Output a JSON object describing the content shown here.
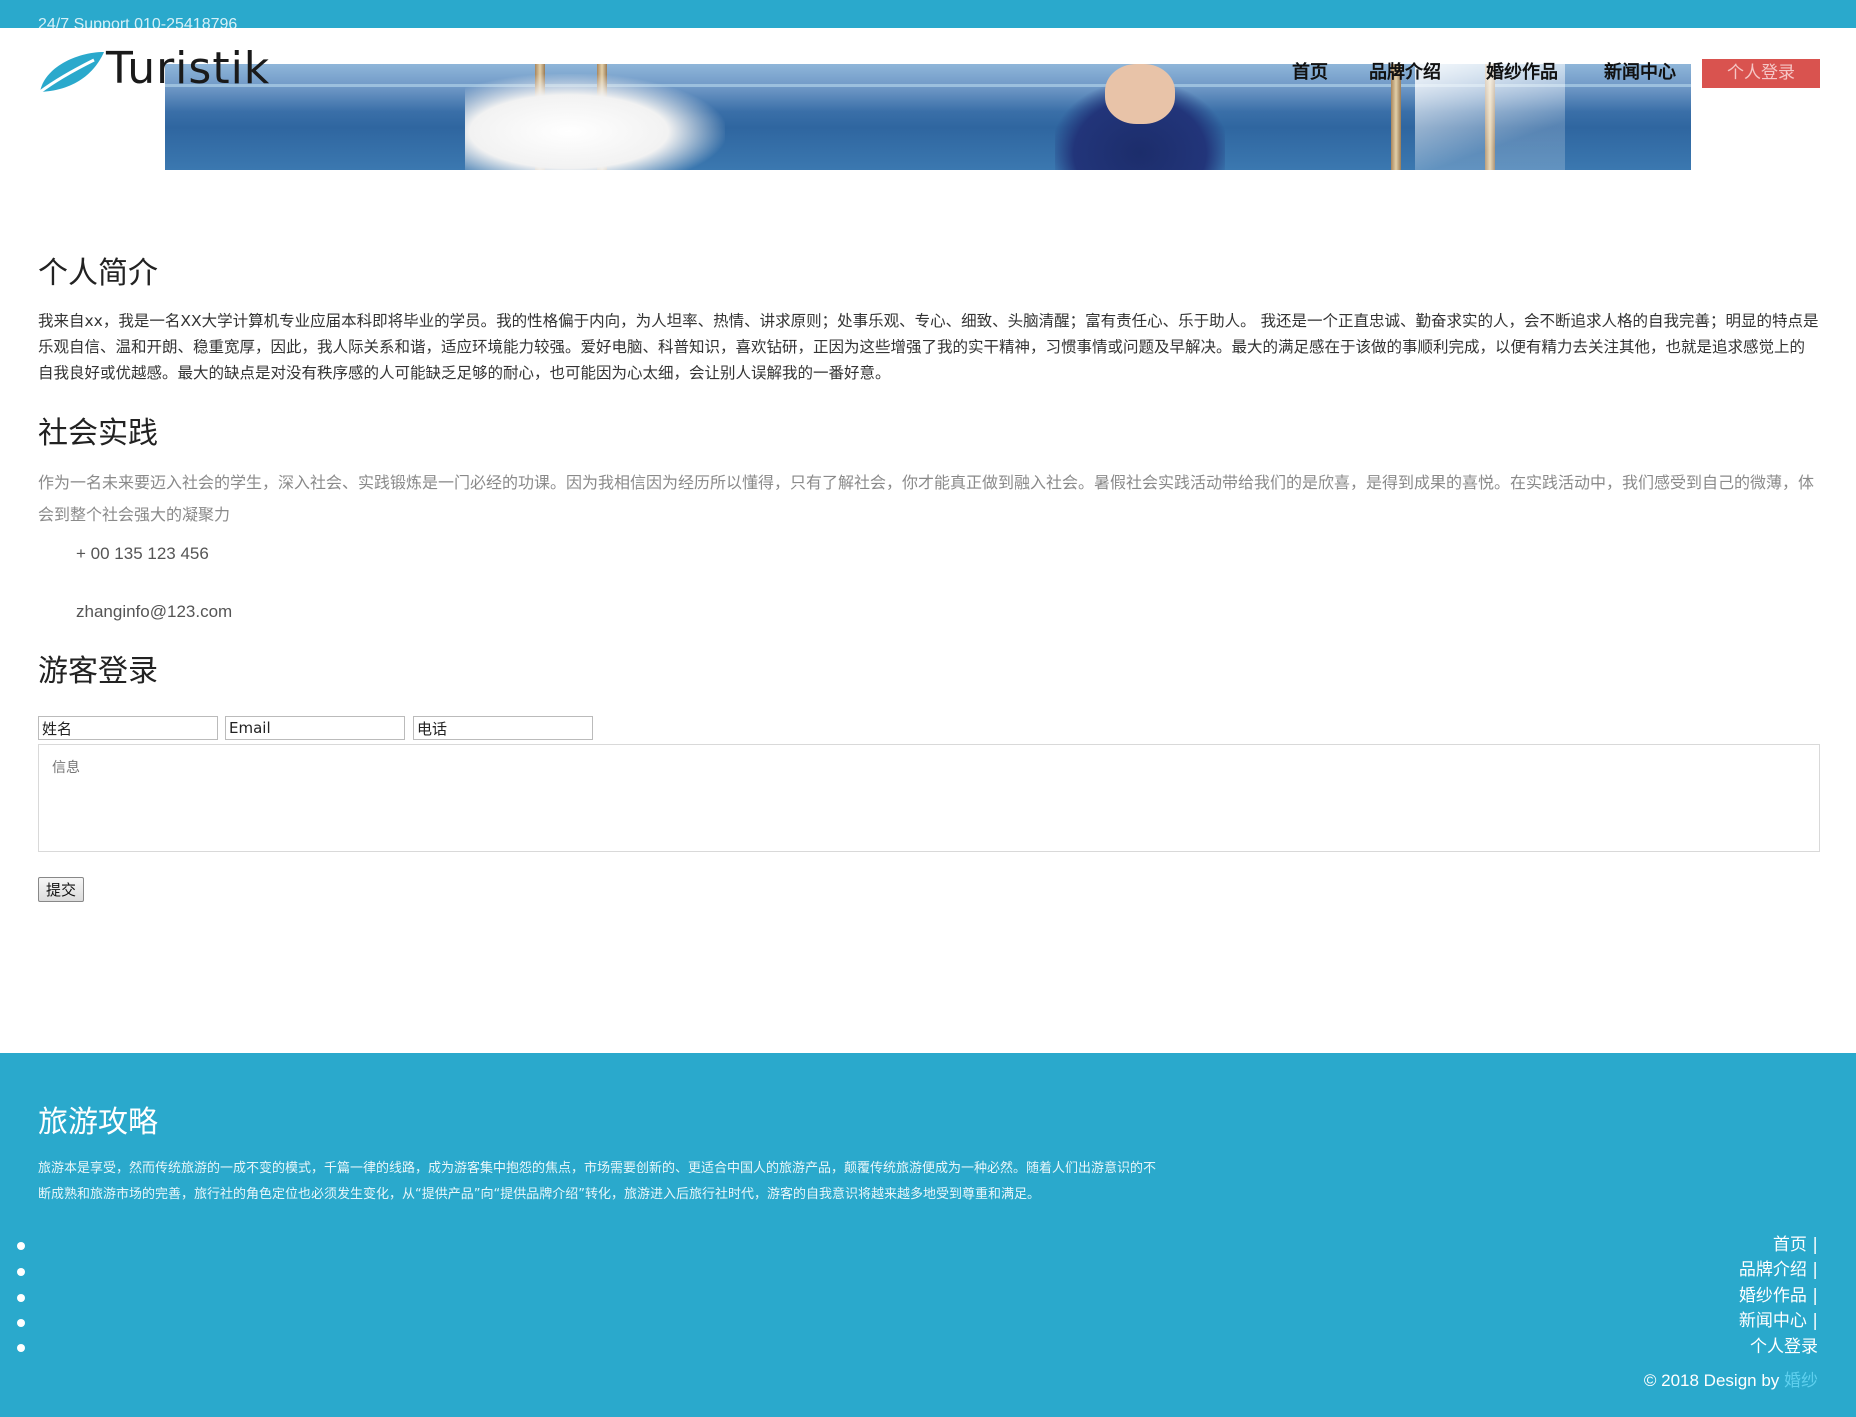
{
  "topbar": {
    "support": "24/7 Support 010-25418796"
  },
  "header": {
    "logo_text": "Turistik",
    "nav": [
      "首页",
      "品牌介绍",
      "婚纱作品",
      "新闻中心"
    ],
    "login_button": "个人登录"
  },
  "about": {
    "title": "个人简介",
    "paragraph": "我来自xx，我是一名XX大学计算机专业应届本科即将毕业的学员。我的性格偏于内向，为人坦率、热情、讲求原则；处事乐观、专心、细致、头脑清醒；富有责任心、乐于助人。 我还是一个正直忠诚、勤奋求实的人，会不断追求人格的自我完善；明显的特点是乐观自信、温和开朗、稳重宽厚，因此，我人际关系和谐，适应环境能力较强。爱好电脑、科普知识，喜欢钻研，正因为这些增强了我的实干精神，习惯事情或问题及早解决。最大的满足感在于该做的事顺利完成，以便有精力去关注其他，也就是追求感觉上的自我良好或优越感。最大的缺点是对没有秩序感的人可能缺乏足够的耐心，也可能因为心太细，会让别人误解我的一番好意。"
  },
  "practice": {
    "title": "社会实践",
    "paragraph": "作为一名未来要迈入社会的学生，深入社会、实践锻炼是一门必经的功课。因为我相信因为经历所以懂得，只有了解社会，你才能真正做到融入社会。暑假社会实践活动带给我们的是欣喜，是得到成果的喜悦。在实践活动中，我们感受到自己的微薄，体会到整个社会强大的凝聚力",
    "phone": "+ 00 135 123 456",
    "email": "zhanginfo@123.com"
  },
  "guest_login": {
    "title": "游客登录",
    "name_value": "姓名",
    "email_value": "Email",
    "phone_value": "电话",
    "message_placeholder": "信息",
    "submit_label": "提交"
  },
  "footer": {
    "title": "旅游攻略",
    "paragraph": "旅游本是享受，然而传统旅游的一成不变的模式，千篇一律的线路，成为游客集中抱怨的焦点，市场需要创新的、更适合中国人的旅游产品，颠覆传统旅游便成为一种必然。随着人们出游意识的不断成熟和旅游市场的完善，旅行社的角色定位也必须发生变化，从“提供产品”向“提供品牌介绍”转化，旅游进入后旅行社时代，游客的自我意识将越来越多地受到尊重和满足。",
    "links": [
      "首页 |",
      "品牌介绍 |",
      "婚纱作品 |",
      "新闻中心 |",
      "个人登录"
    ],
    "copyright_prefix": "© 2018 Design by ",
    "copyright_brand": "婚纱"
  },
  "colors": {
    "primary": "#2aa9cc",
    "login_button": "#d9534f"
  },
  "icons": {
    "logo": "leaf-logo-icon"
  }
}
